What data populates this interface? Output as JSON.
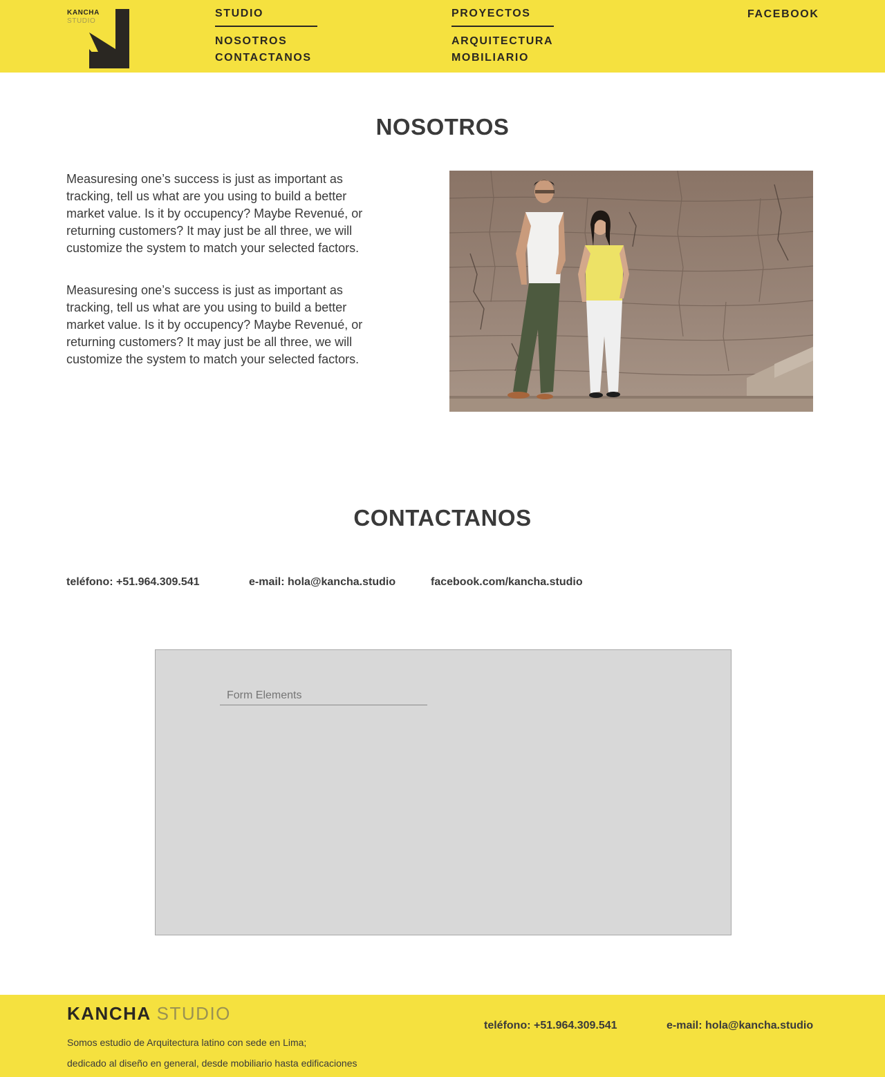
{
  "header": {
    "logo": {
      "word": "KANCHA",
      "sub": "STUDIO"
    },
    "nav": {
      "studio": {
        "head": "STUDIO",
        "links": [
          "NOSOTROS",
          "CONTACTANOS"
        ]
      },
      "proyectos": {
        "head": "PROYECTOS",
        "links": [
          "ARQUITECTURA",
          "MOBILIARIO"
        ]
      },
      "facebook": "FACEBOOK"
    }
  },
  "nosotros": {
    "title": "NOSOTROS",
    "paragraphs": [
      "Measuresing one’s success is just as important as tracking, tell us what are you using to build a better market value. Is it by occupency? Maybe Revenué, or returning customers? It may just be all three, we will customize the system to match your selected factors.",
      "Measuresing one’s success is just as important as tracking, tell us what are you using to build a better market value. Is it by occupency? Maybe Revenué, or returning customers? It may just be all three, we will customize the system to match your selected factors."
    ]
  },
  "contact": {
    "title": "CONTACTANOS",
    "phone": "teléfono: +51.964.309.541",
    "email": "e-mail: hola@kancha.studio",
    "facebook": "facebook.com/kancha.studio",
    "form": {
      "field_placeholder": "Form Elements"
    }
  },
  "footer": {
    "brand_bold": "KANCHA",
    "brand_light": "STUDIO",
    "desc_line1": "Somos estudio de Arquitectura latino con sede en Lima;",
    "desc_line2": "dedicado al diseño en general, desde mobiliario hasta edificaciones",
    "phone": "teléfono: +51.964.309.541",
    "email": "e-mail: hola@kancha.studio"
  },
  "colors": {
    "brand_yellow": "#f5e13f",
    "brand_dark": "#2a2722",
    "text": "#3a3a3a"
  }
}
